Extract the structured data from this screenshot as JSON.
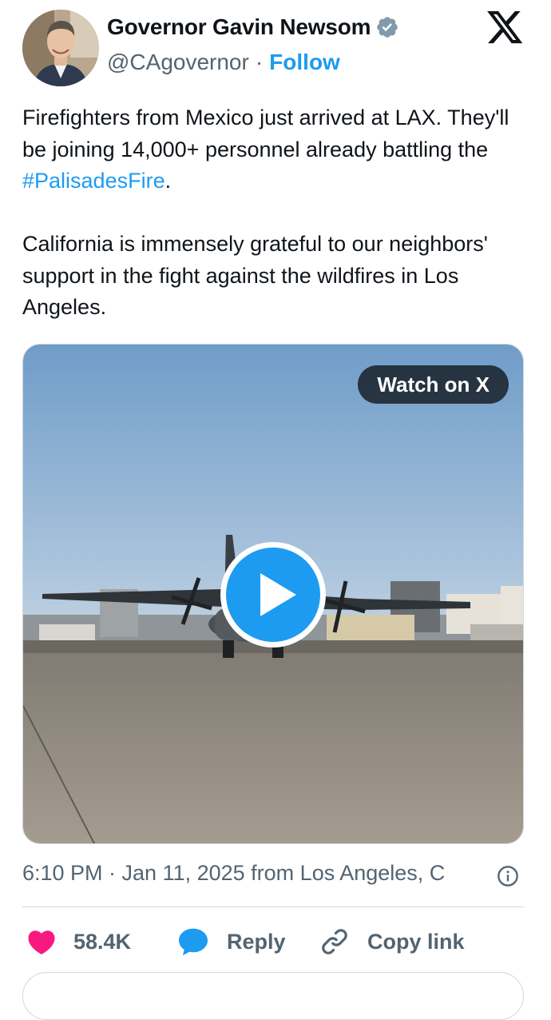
{
  "author": {
    "name": "Governor Gavin Newsom",
    "handle": "@CAgovernor",
    "separator": "·",
    "follow_label": "Follow"
  },
  "tweet": {
    "line1_text": "Firefighters from Mexico just arrived at LAX. They'll be joining 14,000+ personnel already battling the ",
    "hashtag": "#PalisadesFire",
    "line1_end": ".",
    "paragraph2": "California is immensely grateful to our neighbors' support in the fight against the wildfires in Los Angeles."
  },
  "media": {
    "watch_label": "Watch on X"
  },
  "meta": {
    "timestamp": "6:10 PM · Jan 11, 2025 from Los Angeles, C"
  },
  "actions": {
    "likes_count": "58.4K",
    "reply_label": "Reply",
    "copy_label": "Copy link"
  },
  "colors": {
    "accent": "#1d9bf0",
    "like": "#f91880",
    "text": "#0f1419",
    "muted": "#536471"
  },
  "icons": [
    "verified-badge-icon",
    "x-logo-icon",
    "play-icon",
    "info-icon",
    "heart-icon",
    "reply-bubble-icon",
    "link-icon"
  ]
}
